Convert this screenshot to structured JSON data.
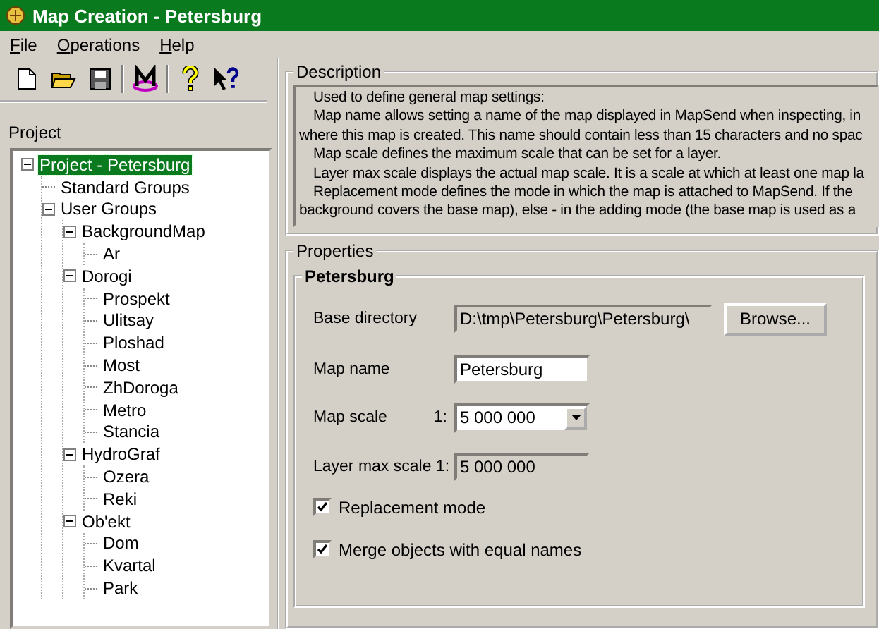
{
  "window": {
    "title": "Map Creation - Petersburg"
  },
  "menu": [
    {
      "label": "File"
    },
    {
      "label": "Operations"
    },
    {
      "label": "Help"
    }
  ],
  "toolbar": [
    {
      "kind": "new"
    },
    {
      "kind": "open"
    },
    {
      "kind": "save"
    },
    {
      "kind": "separator"
    },
    {
      "kind": "logo"
    },
    {
      "kind": "separator"
    },
    {
      "kind": "help"
    },
    {
      "kind": "context_help"
    }
  ],
  "project": {
    "label": "Project",
    "tree": [
      {
        "label": "Project - Petersburg",
        "selected": true,
        "expanded": true,
        "children": [
          {
            "label": "Standard Groups",
            "selected": false
          },
          {
            "label": "User Groups",
            "selected": false,
            "expanded": true,
            "children": [
              {
                "label": "BackgroundMap",
                "selected": false,
                "expanded": true,
                "children": [
                  {
                    "label": "Ar",
                    "selected": false
                  }
                ]
              },
              {
                "label": "Dorogi",
                "selected": false,
                "expanded": true,
                "children": [
                  {
                    "label": "Prospekt",
                    "selected": false
                  },
                  {
                    "label": "Ulitsay",
                    "selected": false
                  },
                  {
                    "label": "Ploshad",
                    "selected": false
                  },
                  {
                    "label": "Most",
                    "selected": false
                  },
                  {
                    "label": "ZhDoroga",
                    "selected": false
                  },
                  {
                    "label": "Metro",
                    "selected": false
                  },
                  {
                    "label": "Stancia",
                    "selected": false
                  }
                ]
              },
              {
                "label": "HydroGraf",
                "selected": false,
                "expanded": true,
                "children": [
                  {
                    "label": "Ozera",
                    "selected": false
                  },
                  {
                    "label": "Reki",
                    "selected": false
                  }
                ]
              },
              {
                "label": "Ob'ekt",
                "selected": false,
                "expanded": true,
                "children": [
                  {
                    "label": "Dom",
                    "selected": false
                  },
                  {
                    "label": "Kvartal",
                    "selected": false
                  },
                  {
                    "label": "Park",
                    "selected": false
                  }
                ]
              }
            ]
          }
        ]
      }
    ]
  },
  "description": {
    "title": "Description",
    "lines": [
      {
        "text": "Used to define general map settings:",
        "indent": true
      },
      {
        "text": "Map name allows setting a name of the map displayed in MapSend when inspecting, in",
        "indent": true
      },
      {
        "text": "where this map is created. This name should contain less than 15 characters and no spac",
        "indent": false
      },
      {
        "text": "Map scale defines the maximum scale that can be set for a layer.",
        "indent": true
      },
      {
        "text": "Layer max scale displays the actual map scale. It is a scale at which at least one map la",
        "indent": true
      },
      {
        "text": "Replacement mode defines the mode in which the map is attached to MapSend. If the",
        "indent": true
      },
      {
        "text": "background covers the base map), else - in the adding mode (the base map is used as a",
        "indent": false
      }
    ]
  },
  "properties": {
    "title": "Properties",
    "group": "Petersburg",
    "base_directory": {
      "label": "Base directory",
      "value": "D:\\tmp\\Petersburg\\Petersburg\\",
      "button": "Browse..."
    },
    "map_name": {
      "label": "Map name",
      "value": "Petersburg"
    },
    "map_scale": {
      "label": "Map scale",
      "prefix": "1:",
      "value": "5 000 000"
    },
    "layer_max_scale": {
      "label": "Layer max scale 1:",
      "value": "5 000 000"
    },
    "checkboxes": [
      {
        "label": "Replacement mode",
        "checked": true
      },
      {
        "label": "Merge objects with equal names",
        "checked": true
      }
    ]
  }
}
